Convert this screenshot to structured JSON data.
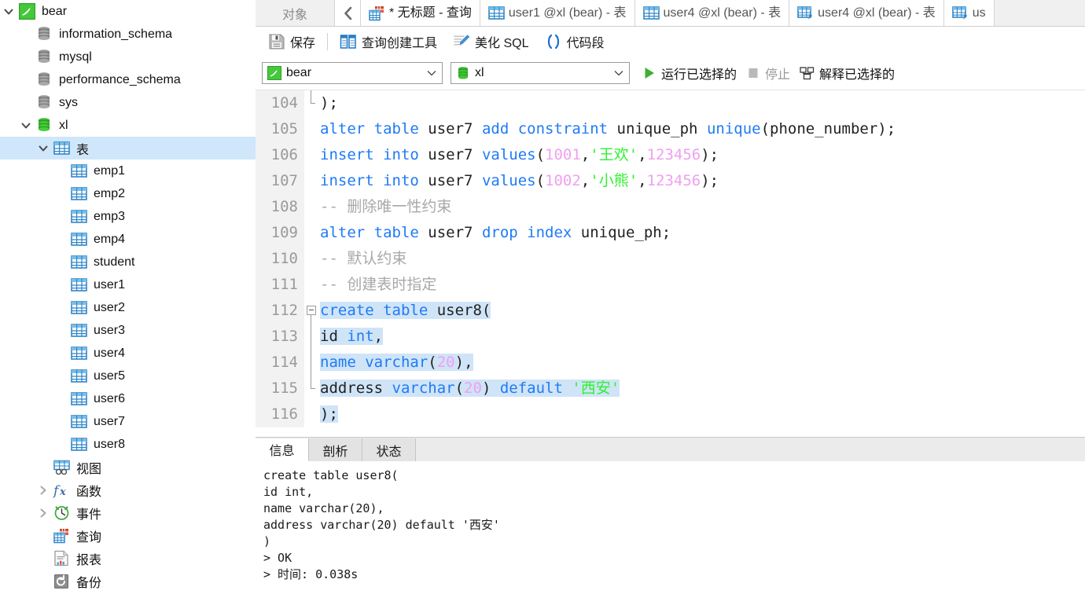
{
  "sidebar": {
    "items": [
      {
        "label": "bear",
        "icon": "mysql-connection-icon",
        "indent": 0,
        "twisty": "down",
        "selected": false
      },
      {
        "label": "information_schema",
        "icon": "database-gray-icon",
        "indent": 1,
        "twisty": "none",
        "selected": false
      },
      {
        "label": "mysql",
        "icon": "database-gray-icon",
        "indent": 1,
        "twisty": "none",
        "selected": false
      },
      {
        "label": "performance_schema",
        "icon": "database-gray-icon",
        "indent": 1,
        "twisty": "none",
        "selected": false
      },
      {
        "label": "sys",
        "icon": "database-gray-icon",
        "indent": 1,
        "twisty": "none",
        "selected": false
      },
      {
        "label": "xl",
        "icon": "database-green-icon",
        "indent": 1,
        "twisty": "down",
        "selected": false
      },
      {
        "label": "表",
        "icon": "table-folder-icon",
        "indent": 2,
        "twisty": "down",
        "selected": true
      },
      {
        "label": "emp1",
        "icon": "table-icon",
        "indent": 3,
        "twisty": "none",
        "selected": false
      },
      {
        "label": "emp2",
        "icon": "table-icon",
        "indent": 3,
        "twisty": "none",
        "selected": false
      },
      {
        "label": "emp3",
        "icon": "table-icon",
        "indent": 3,
        "twisty": "none",
        "selected": false
      },
      {
        "label": "emp4",
        "icon": "table-icon",
        "indent": 3,
        "twisty": "none",
        "selected": false
      },
      {
        "label": "student",
        "icon": "table-icon",
        "indent": 3,
        "twisty": "none",
        "selected": false
      },
      {
        "label": "user1",
        "icon": "table-icon",
        "indent": 3,
        "twisty": "none",
        "selected": false
      },
      {
        "label": "user2",
        "icon": "table-icon",
        "indent": 3,
        "twisty": "none",
        "selected": false
      },
      {
        "label": "user3",
        "icon": "table-icon",
        "indent": 3,
        "twisty": "none",
        "selected": false
      },
      {
        "label": "user4",
        "icon": "table-icon",
        "indent": 3,
        "twisty": "none",
        "selected": false
      },
      {
        "label": "user5",
        "icon": "table-icon",
        "indent": 3,
        "twisty": "none",
        "selected": false
      },
      {
        "label": "user6",
        "icon": "table-icon",
        "indent": 3,
        "twisty": "none",
        "selected": false
      },
      {
        "label": "user7",
        "icon": "table-icon",
        "indent": 3,
        "twisty": "none",
        "selected": false
      },
      {
        "label": "user8",
        "icon": "table-icon",
        "indent": 3,
        "twisty": "none",
        "selected": false
      },
      {
        "label": "视图",
        "icon": "view-icon",
        "indent": 2,
        "twisty": "none",
        "selected": false
      },
      {
        "label": "函数",
        "icon": "function-icon",
        "indent": 2,
        "twisty": "right",
        "selected": false
      },
      {
        "label": "事件",
        "icon": "event-clock-icon",
        "indent": 2,
        "twisty": "right",
        "selected": false
      },
      {
        "label": "查询",
        "icon": "query-icon",
        "indent": 2,
        "twisty": "none",
        "selected": false
      },
      {
        "label": "报表",
        "icon": "report-icon",
        "indent": 2,
        "twisty": "none",
        "selected": false
      },
      {
        "label": "备份",
        "icon": "backup-icon",
        "indent": 2,
        "twisty": "none",
        "selected": false
      }
    ]
  },
  "tabstrip": {
    "objects_label": "对象",
    "back_icon": "chevron-left-icon",
    "tabs": [
      {
        "label": "* 无标题 - 查询",
        "icon": "query-icon",
        "active": true
      },
      {
        "label": "user1 @xl (bear) - 表",
        "icon": "table-icon",
        "active": false
      },
      {
        "label": "user4 @xl (bear) - 表",
        "icon": "table-icon",
        "active": false
      },
      {
        "label": "user4 @xl (bear) - 表",
        "icon": "table-edit-icon",
        "active": false
      },
      {
        "label": "us",
        "icon": "table-edit-icon",
        "active": false
      }
    ]
  },
  "toolbar": {
    "save_label": "保存",
    "query_builder_label": "查询创建工具",
    "beautify_label": "美化 SQL",
    "snippet_label": "代码段"
  },
  "runbar": {
    "connection": "bear",
    "database": "xl",
    "run_selected_label": "运行已选择的",
    "stop_label": "停止",
    "explain_selected_label": "解释已选择的"
  },
  "editor": {
    "first_line": 104,
    "lines": [
      {
        "n": 104,
        "tokens": [
          {
            "t": ");",
            "c": "pn"
          }
        ],
        "fold": "end",
        "sel": false
      },
      {
        "n": 105,
        "tokens": [
          {
            "t": "alter",
            "c": "kw"
          },
          {
            "t": " ",
            "c": "pn"
          },
          {
            "t": "table",
            "c": "kw"
          },
          {
            "t": " user7 ",
            "c": "id"
          },
          {
            "t": "add",
            "c": "kw"
          },
          {
            "t": " ",
            "c": "pn"
          },
          {
            "t": "constraint",
            "c": "kw"
          },
          {
            "t": " unique_ph ",
            "c": "id"
          },
          {
            "t": "unique",
            "c": "kw"
          },
          {
            "t": "(phone_number);",
            "c": "id"
          }
        ],
        "fold": "none",
        "sel": false
      },
      {
        "n": 106,
        "tokens": [
          {
            "t": "insert",
            "c": "kw"
          },
          {
            "t": " ",
            "c": "pn"
          },
          {
            "t": "into",
            "c": "kw"
          },
          {
            "t": " user7 ",
            "c": "id"
          },
          {
            "t": "values",
            "c": "kw"
          },
          {
            "t": "(",
            "c": "id"
          },
          {
            "t": "1001",
            "c": "num"
          },
          {
            "t": ",",
            "c": "id"
          },
          {
            "t": "'王欢'",
            "c": "str"
          },
          {
            "t": ",",
            "c": "id"
          },
          {
            "t": "123456",
            "c": "num"
          },
          {
            "t": ");",
            "c": "id"
          }
        ],
        "fold": "none",
        "sel": false
      },
      {
        "n": 107,
        "tokens": [
          {
            "t": "insert",
            "c": "kw"
          },
          {
            "t": " ",
            "c": "pn"
          },
          {
            "t": "into",
            "c": "kw"
          },
          {
            "t": " user7 ",
            "c": "id"
          },
          {
            "t": "values",
            "c": "kw"
          },
          {
            "t": "(",
            "c": "id"
          },
          {
            "t": "1002",
            "c": "num"
          },
          {
            "t": ",",
            "c": "id"
          },
          {
            "t": "'小熊'",
            "c": "str"
          },
          {
            "t": ",",
            "c": "id"
          },
          {
            "t": "123456",
            "c": "num"
          },
          {
            "t": ");",
            "c": "id"
          }
        ],
        "fold": "none",
        "sel": false
      },
      {
        "n": 108,
        "tokens": [
          {
            "t": "-- 删除唯一性约束",
            "c": "cmt"
          }
        ],
        "fold": "none",
        "sel": false
      },
      {
        "n": 109,
        "tokens": [
          {
            "t": "alter",
            "c": "kw"
          },
          {
            "t": " ",
            "c": "pn"
          },
          {
            "t": "table",
            "c": "kw"
          },
          {
            "t": " user7 ",
            "c": "id"
          },
          {
            "t": "drop",
            "c": "kw"
          },
          {
            "t": " ",
            "c": "pn"
          },
          {
            "t": "index",
            "c": "kw"
          },
          {
            "t": " unique_ph;",
            "c": "id"
          }
        ],
        "fold": "none",
        "sel": false
      },
      {
        "n": 110,
        "tokens": [
          {
            "t": "-- 默认约束",
            "c": "cmt"
          }
        ],
        "fold": "none",
        "sel": false
      },
      {
        "n": 111,
        "tokens": [
          {
            "t": "-- 创建表时指定",
            "c": "cmt"
          }
        ],
        "fold": "none",
        "sel": false
      },
      {
        "n": 112,
        "tokens": [
          {
            "t": "create",
            "c": "kw"
          },
          {
            "t": " ",
            "c": "pn"
          },
          {
            "t": "table",
            "c": "kw"
          },
          {
            "t": " user8(",
            "c": "id"
          }
        ],
        "fold": "start",
        "sel": true
      },
      {
        "n": 113,
        "tokens": [
          {
            "t": "id ",
            "c": "id"
          },
          {
            "t": "int",
            "c": "kw"
          },
          {
            "t": ",",
            "c": "id"
          }
        ],
        "fold": "mid",
        "sel": true
      },
      {
        "n": 114,
        "tokens": [
          {
            "t": "name ",
            "c": "kw"
          },
          {
            "t": "varchar",
            "c": "kw"
          },
          {
            "t": "(",
            "c": "id"
          },
          {
            "t": "20",
            "c": "num"
          },
          {
            "t": "),",
            "c": "id"
          }
        ],
        "fold": "mid",
        "sel": true
      },
      {
        "n": 115,
        "tokens": [
          {
            "t": "address ",
            "c": "id"
          },
          {
            "t": "varchar",
            "c": "kw"
          },
          {
            "t": "(",
            "c": "id"
          },
          {
            "t": "20",
            "c": "num"
          },
          {
            "t": ") ",
            "c": "id"
          },
          {
            "t": "default",
            "c": "kw"
          },
          {
            "t": " ",
            "c": "pn"
          },
          {
            "t": "'西安'",
            "c": "str"
          }
        ],
        "fold": "stop",
        "sel": true
      },
      {
        "n": 116,
        "tokens": [
          {
            "t": ");",
            "c": "id"
          }
        ],
        "fold": "none",
        "sel": true
      }
    ]
  },
  "result": {
    "tabs": [
      {
        "label": "信息",
        "active": true
      },
      {
        "label": "剖析",
        "active": false
      },
      {
        "label": "状态",
        "active": false
      }
    ],
    "message": "create table user8(\nid int,\nname varchar(20),\naddress varchar(20) default '西安'\n)\n> OK\n> 时间: 0.038s"
  },
  "colors": {
    "selection": "#cfe4f7",
    "tree_selection": "#cfe6fb",
    "keyword": "#1f7bf5",
    "string": "#2ef22e",
    "number": "#f0a0f0",
    "comment": "#a8a8a8",
    "run_green": "#3cb034"
  }
}
